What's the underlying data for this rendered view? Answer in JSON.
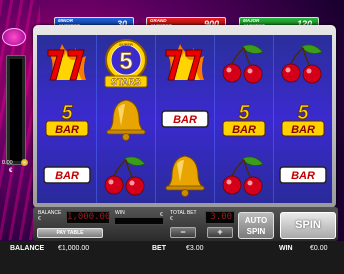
{
  "jackpots": [
    {
      "label_line1": "MINOR",
      "label_line2": "JACKPOT",
      "value": "30",
      "color": "#1d5fd6"
    },
    {
      "label_line1": "GRAND",
      "label_line2": "JACKPOT",
      "value": "900",
      "color": "#e21b1b"
    },
    {
      "label_line1": "MAJOR",
      "label_line2": "JACKPOT",
      "value": "120",
      "color": "#27b53a"
    }
  ],
  "reels": {
    "rows": [
      [
        "seven",
        "super-5-stars",
        "seven",
        "cherries",
        "cherries"
      ],
      [
        "five-bar",
        "bell",
        "bar",
        "five-bar",
        "five-bar"
      ],
      [
        "bar",
        "cherries",
        "bell",
        "cherries",
        "bar"
      ]
    ],
    "bar_label": "BAR",
    "five_label": "5",
    "stars_label": "STARS",
    "super_label": "SUPER"
  },
  "meter": {
    "value": "0.00",
    "currency": "€"
  },
  "panel": {
    "balance_label": "BALANCE",
    "balance_currency": "€",
    "balance_value": "1,000.00",
    "win_label": "WIN",
    "win_currency": "€",
    "total_bet_label": "TOTAL BET",
    "total_bet_currency": "€",
    "total_bet_value": "3.00",
    "pay_table_label": "PAY TABLE",
    "minus_label": "−",
    "plus_label": "+",
    "auto_spin_label_1": "AUTO",
    "auto_spin_label_2": "SPIN",
    "spin_label": "SPIN"
  },
  "bottom_bar": {
    "balance_label": "BALANCE",
    "balance_value": "€1,000.00",
    "bet_label": "BET",
    "bet_value": "€3.00",
    "win_label": "WIN",
    "win_value": "€0.00"
  }
}
